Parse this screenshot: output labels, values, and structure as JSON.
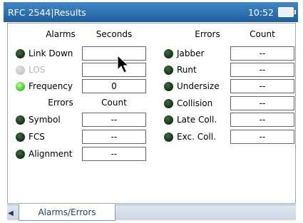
{
  "titlebar": {
    "title": "RFC 2544|Results",
    "clock": "10:52"
  },
  "left": {
    "alarms_header": "Alarms",
    "seconds_header": "Seconds",
    "alarms": [
      {
        "label": "Link Down",
        "value": "",
        "led": "dark",
        "disabled": false
      },
      {
        "label": "LOS",
        "value": "",
        "led": "off",
        "disabled": true
      },
      {
        "label": "Frequency",
        "value": "0",
        "led": "green",
        "disabled": false
      }
    ],
    "errors_header": "Errors",
    "count_header": "Count",
    "errors": [
      {
        "label": "Symbol",
        "value": "--",
        "led": "dark"
      },
      {
        "label": "FCS",
        "value": "--",
        "led": "dark"
      },
      {
        "label": "Alignment",
        "value": "--",
        "led": "dark"
      }
    ]
  },
  "right": {
    "errors_header": "Errors",
    "count_header": "Count",
    "errors": [
      {
        "label": "Jabber",
        "value": "--",
        "led": "dark"
      },
      {
        "label": "Runt",
        "value": "--",
        "led": "dark"
      },
      {
        "label": "Undersize",
        "value": "--",
        "led": "dark"
      },
      {
        "label": "Collision",
        "value": "--",
        "led": "dark"
      },
      {
        "label": "Late Coll.",
        "value": "--",
        "led": "dark"
      },
      {
        "label": "Exc. Coll.",
        "value": "--",
        "led": "dark"
      }
    ]
  },
  "tabs": [
    {
      "label": "Alarms/Errors",
      "active": true
    }
  ],
  "colors": {
    "titlebar": "#2f74b8",
    "led_dark": "#1a3a1a",
    "led_green": "#4cd12b",
    "led_off": "#cfcfcf"
  }
}
